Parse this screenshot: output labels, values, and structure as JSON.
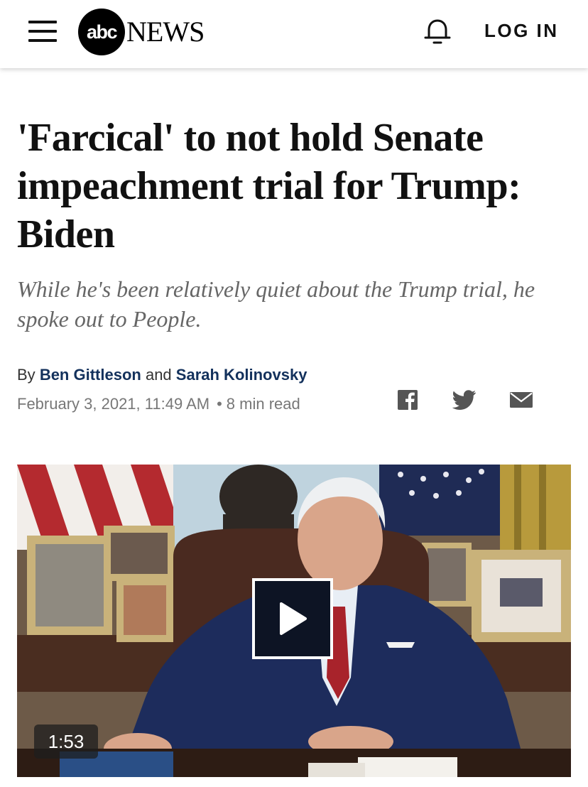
{
  "header": {
    "menu_icon": "hamburger-menu-icon",
    "logo_mark": "abc",
    "logo_word": "NEWS",
    "notification_icon": "bell-icon",
    "login_label": "LOG IN"
  },
  "article": {
    "headline": "'Farcical' to not hold Senate impeachment trial for Trump: Biden",
    "subheadline": "While he's been relatively quiet about the Trump trial, he spoke out to People.",
    "byline_prefix": "By",
    "author_1": "Ben Gittleson",
    "byline_conjunction": "and",
    "author_2": "Sarah Kolinovsky",
    "date": "February 3, 2021, 11:49 AM",
    "separator": "•",
    "read_time": "8 min read"
  },
  "share": {
    "facebook_icon": "facebook-icon",
    "twitter_icon": "twitter-icon",
    "email_icon": "email-icon"
  },
  "video": {
    "play_icon": "play-icon",
    "duration": "1:53"
  },
  "colors": {
    "author_link": "#13315c",
    "headline": "#111111",
    "subheadline": "#666666",
    "meta": "#777777",
    "share_icons": "#555555"
  }
}
